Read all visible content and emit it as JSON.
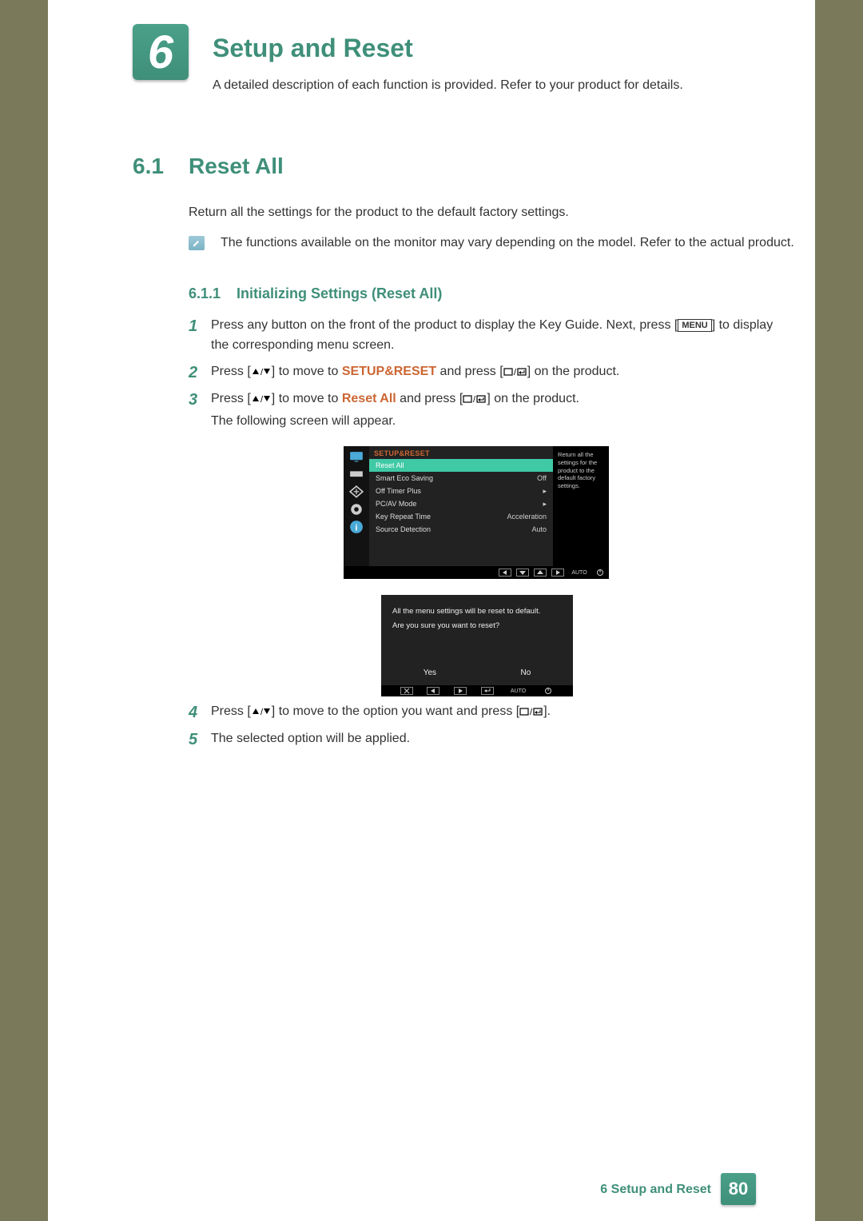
{
  "chapter": {
    "number": "6",
    "title": "Setup and Reset",
    "desc": "A detailed description of each function is provided. Refer to your product for details."
  },
  "section": {
    "number": "6.1",
    "title": "Reset All",
    "desc": "Return all the settings for the product to the default factory settings.",
    "note": "The functions available on the monitor may vary depending on the model. Refer to the actual product."
  },
  "subsection": {
    "number": "6.1.1",
    "title": "Initializing Settings (Reset All)"
  },
  "steps": {
    "s1": {
      "num": "1",
      "a": "Press any button on the front of the product to display the Key Guide. Next, press [",
      "menu": "MENU",
      "b": "] to display the corresponding menu screen."
    },
    "s2": {
      "num": "2",
      "a": "Press [",
      "b": "] to move to ",
      "hl": "SETUP&RESET",
      "c": " and press [",
      "d": "] on the product."
    },
    "s3": {
      "num": "3",
      "a": "Press [",
      "b": "] to move to ",
      "hl": "Reset All",
      "c": " and press [",
      "d": "] on the product.",
      "tail": "The following screen will appear."
    },
    "s4": {
      "num": "4",
      "a": "Press [",
      "b": "] to move to the option you want and press [",
      "c": "]."
    },
    "s5": {
      "num": "5",
      "text": "The selected option will be applied."
    }
  },
  "osd": {
    "heading": "SETUP&RESET",
    "rows": [
      {
        "label": "Reset All",
        "val": "",
        "active": true
      },
      {
        "label": "Smart Eco Saving",
        "val": "Off"
      },
      {
        "label": "Off Timer Plus",
        "val": "▸"
      },
      {
        "label": "PC/AV Mode",
        "val": "▸"
      },
      {
        "label": "Key Repeat Time",
        "val": "Acceleration"
      },
      {
        "label": "Source Detection",
        "val": "Auto"
      }
    ],
    "help": "Return all the settings for the product to the default factory settings.",
    "nav_auto": "AUTO"
  },
  "confirm": {
    "line1": "All the menu settings will be reset to default.",
    "line2": "Are you sure you want to reset?",
    "yes": "Yes",
    "no": "No",
    "nav_auto": "AUTO"
  },
  "footer": {
    "title": "6 Setup and Reset",
    "page": "80"
  }
}
